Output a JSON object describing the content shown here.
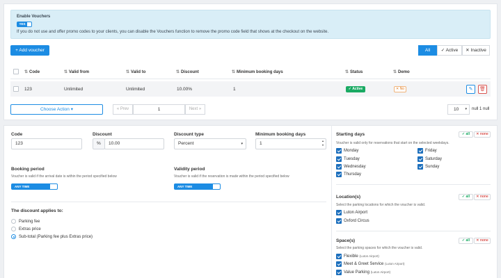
{
  "voucher_settings": {
    "title": "Enable Vouchers",
    "toggle_label": "YES",
    "description": "If you do not use and offer promo codes to your clients, you can disable the Vouchers function to remove the promo code field that shows at the checkout on the website."
  },
  "toolbar": {
    "add_label": "+ Add voucher",
    "filters": [
      "All",
      "✓ Active",
      "✕ Inactive"
    ]
  },
  "table": {
    "headers": [
      "Code",
      "Valid from",
      "Valid to",
      "Discount",
      "Minimum booking days",
      "Status",
      "Demo"
    ],
    "row": {
      "code": "123",
      "valid_from": "Unlimited",
      "valid_to": "Unlimited",
      "discount": "10.00%",
      "min_days": "1",
      "status": "✓ Active",
      "demo": "✕ No"
    }
  },
  "pagination": {
    "action_label": "Choose Action ▾",
    "prev": "« Prev",
    "page": "1",
    "next": "Next »",
    "per_page": "10",
    "info": "null 1 null"
  },
  "form": {
    "code_label": "Code",
    "code_value": "123",
    "discount_label": "Discount",
    "discount_unit": "%",
    "discount_value": "10.00",
    "type_label": "Discount type",
    "type_value": "Percent",
    "min_label": "Minimum booking days",
    "min_value": "1",
    "booking_label": "Booking period",
    "booking_sub": "Voucher is valid if the arrival date is within the period specified below",
    "booking_toggle": "ANY TIME",
    "validity_label": "Validity period",
    "validity_sub": "Voucher is valid if the reservation is made within the period specified below",
    "validity_toggle": "ANY TIME",
    "applies_label": "The discount applies to:",
    "applies_options": [
      "Parking fee",
      "Extras price",
      "Sub-total (Parking fee plus Extras price)"
    ]
  },
  "sidebar": {
    "all": "✓ all",
    "none": "✕ none",
    "days_title": "Starting days",
    "days_sub": "Voucher is valid only for reservations that start on the selected weekdays.",
    "days": [
      "Monday",
      "Tuesday",
      "Wednesday",
      "Thursday",
      "Friday",
      "Saturday",
      "Sunday"
    ],
    "locations_title": "Location(s)",
    "locations_sub": "Select the parking locations for which the voucher is valid.",
    "locations": [
      "Luton Airport",
      "Oxford Circus"
    ],
    "spaces_title": "Space(s)",
    "spaces_sub": "Select the parking spaces for which the voucher is valid.",
    "spaces": [
      {
        "name": "Flexible",
        "loc": "(Luton Airport)"
      },
      {
        "name": "Meet & Greet Service",
        "loc": "(Luton Airport)"
      },
      {
        "name": "Value Parking",
        "loc": "(Luton Airport)"
      }
    ]
  }
}
